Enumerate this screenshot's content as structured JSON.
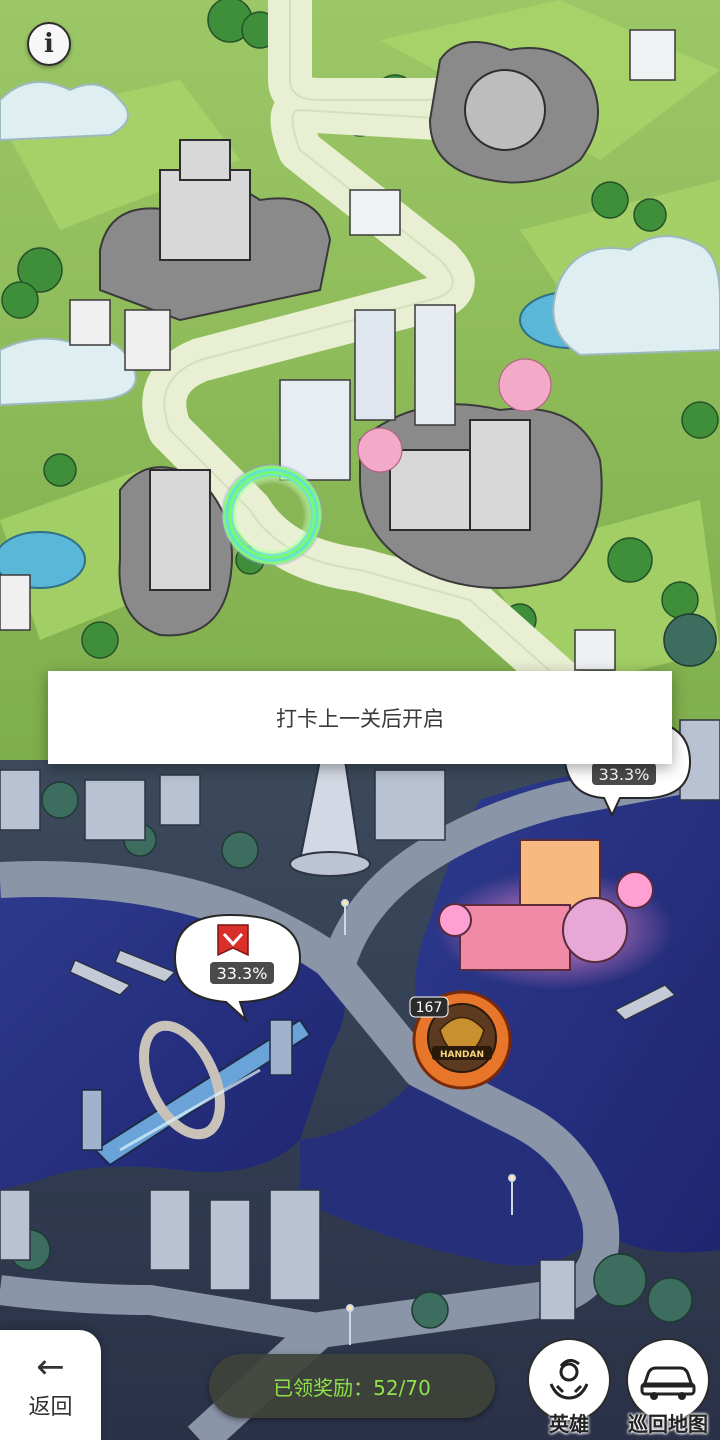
{
  "toast": {
    "text": "打卡上一关后开启"
  },
  "bubbles": [
    {
      "percent": "33.3%"
    },
    {
      "percent": "33.3%"
    }
  ],
  "player": {
    "level": "167",
    "badge_text": "HANDAN"
  },
  "bottom_bar": {
    "back_label": "返回",
    "rewards_label": "已领奖励：52/70",
    "rewards_claimed": 52,
    "rewards_total": 70,
    "hero_label": "英雄",
    "patrol_label": "巡回地图"
  },
  "icons": {
    "info": "info-icon",
    "back": "arrow-left-icon",
    "hero": "hero-icon",
    "patrol": "car-icon",
    "banner": "banner-icon"
  },
  "colors": {
    "rewards_text": "#8fe24b",
    "banner_red": "#d9302c",
    "day_grass": "#8fbf55",
    "night_water": "#2b3586"
  }
}
